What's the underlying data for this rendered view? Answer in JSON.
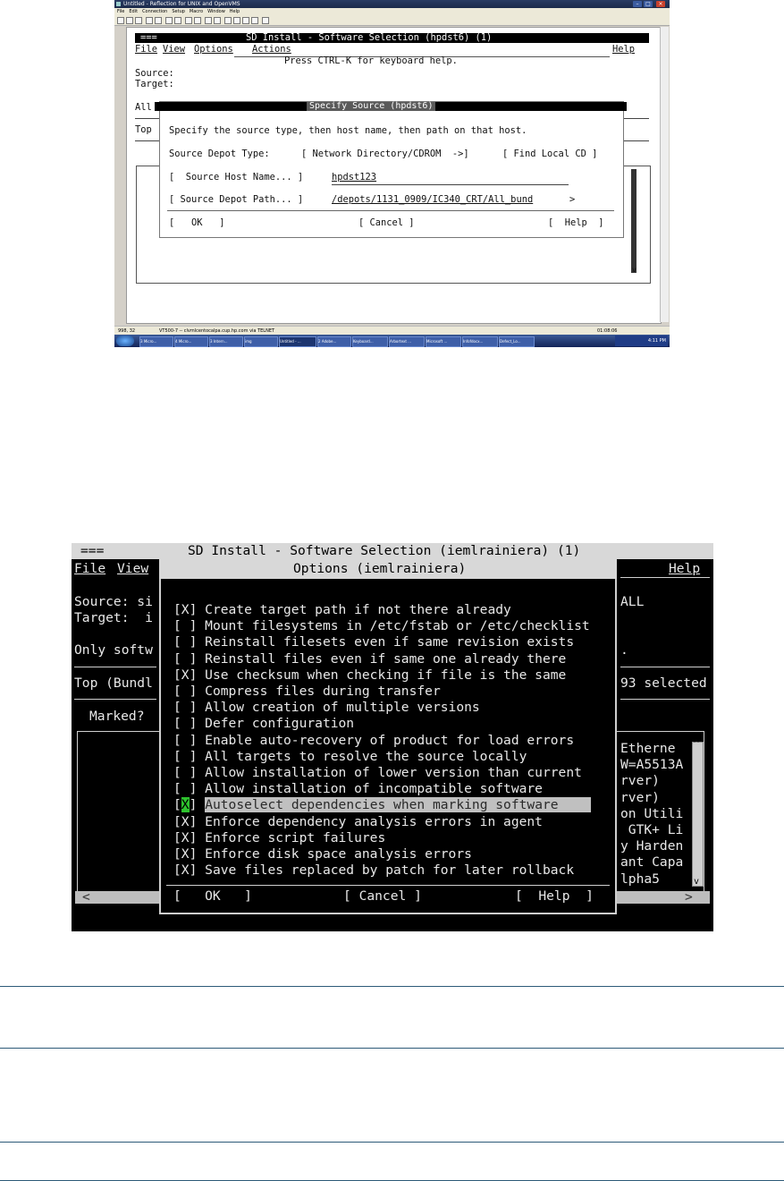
{
  "shot1": {
    "window_title": "Untitled - Reflection for UNIX and OpenVMS",
    "menubar": [
      "File",
      "Edit",
      "Connection",
      "Setup",
      "Macro",
      "Window",
      "Help"
    ],
    "terminal": {
      "header_eq": "===",
      "header_title": "SD Install - Software Selection (hpdst6) (1)",
      "menu_file": "File",
      "menu_view": "View",
      "menu_options": "Options",
      "menu_actions": "Actions",
      "menu_help": "Help",
      "keyboard_help": "Press CTRL-K for keyboard help.",
      "source_label": "Source:",
      "target_label": "Target:",
      "all_label": "All",
      "top_label": "Top",
      "scroll_glyph": "v"
    },
    "dialog": {
      "title": "Specify Source (hpdst6)",
      "instructions": "Specify the source type, then host name, then path on that host.",
      "depot_type_label": "Source Depot Type:",
      "depot_type_value": "[ Network Directory/CDROM  ->]",
      "find_local_cd": "[ Find Local CD ]",
      "host_name_button": "[  Source Host Name... ]",
      "host_name_value": "hpdst123",
      "depot_path_button": "[ Source Depot Path... ]",
      "depot_path_value": "/depots/1131_0909/IC340_CRT/All_bund",
      "depot_path_more": ">",
      "ok": "[   OK   ]",
      "cancel": "[ Cancel ]",
      "help": "[  Help  ]"
    },
    "status": {
      "left": "998, 32",
      "connection": "VT500-7 -- clvmlcentocalpa.cup.hp.com via TELNET",
      "time": "01:08:06"
    },
    "taskbar": {
      "items": [
        "3 Micro...",
        "4 Micro...",
        "3 Intern...",
        "img",
        "Untitled - ...",
        "2 Adobe...",
        "Keyboard...",
        "Arbortext ...",
        "Microsoft ...",
        "Infofdocx...",
        "Defect_Lo..."
      ],
      "clock": "4:11 PM"
    }
  },
  "shot2": {
    "header_eq": "===",
    "header_title": "SD Install - Software Selection (iemlrainiera) (1)",
    "menu_file": "File",
    "menu_view": "View",
    "menu_help": "Help",
    "bg_source": "Source: si",
    "bg_target": "Target:  i",
    "bg_only": "Only softw",
    "bg_top": "Top (Bundl",
    "bg_marked": "Marked?",
    "right_all": "ALL",
    "right_dot": ".",
    "right_selected": "93 selected",
    "right_list": [
      "Etherne",
      "W=A5513A",
      "rver)",
      "rver)",
      "on Utili",
      " GTK+ Li",
      "y Harden",
      "ant Capa",
      "lpha5"
    ],
    "scroll_left": "<",
    "scroll_right": ">",
    "scroll_up": "^",
    "scroll_down": "v",
    "dialog_title": "Options (iemlrainiera)",
    "options": [
      {
        "check": "[X]",
        "label": "Create target path if not there already"
      },
      {
        "check": "[ ]",
        "label": "Mount filesystems in /etc/fstab or /etc/checklist"
      },
      {
        "check": "[ ]",
        "label": "Reinstall filesets even if same revision exists"
      },
      {
        "check": "[ ]",
        "label": "Reinstall files even if same one already there"
      },
      {
        "check": "[X]",
        "label": "Use checksum when checking if file is the same"
      },
      {
        "check": "[ ]",
        "label": "Compress files during transfer"
      },
      {
        "check": "[ ]",
        "label": "Allow creation of multiple versions"
      },
      {
        "check": "[ ]",
        "label": "Defer configuration"
      },
      {
        "check": "[ ]",
        "label": "Enable auto-recovery of product for load errors"
      },
      {
        "check": "[ ]",
        "label": "All targets to resolve the source locally"
      },
      {
        "check": "[ ]",
        "label": "Allow installation of lower version than current"
      },
      {
        "check": "[ ]",
        "label": "Allow installation of incompatible software"
      },
      {
        "check": "[X]",
        "label": "Autoselect dependencies when marking software"
      },
      {
        "check": "[X]",
        "label": "Enforce dependency analysis errors in agent"
      },
      {
        "check": "[X]",
        "label": "Enforce script failures"
      },
      {
        "check": "[X]",
        "label": "Enforce disk space analysis errors"
      },
      {
        "check": "[X]",
        "label": "Save files replaced by patch for later rollback"
      }
    ],
    "ok": "[   OK   ]",
    "cancel": "[ Cancel ]",
    "help": "[  Help  ]"
  }
}
